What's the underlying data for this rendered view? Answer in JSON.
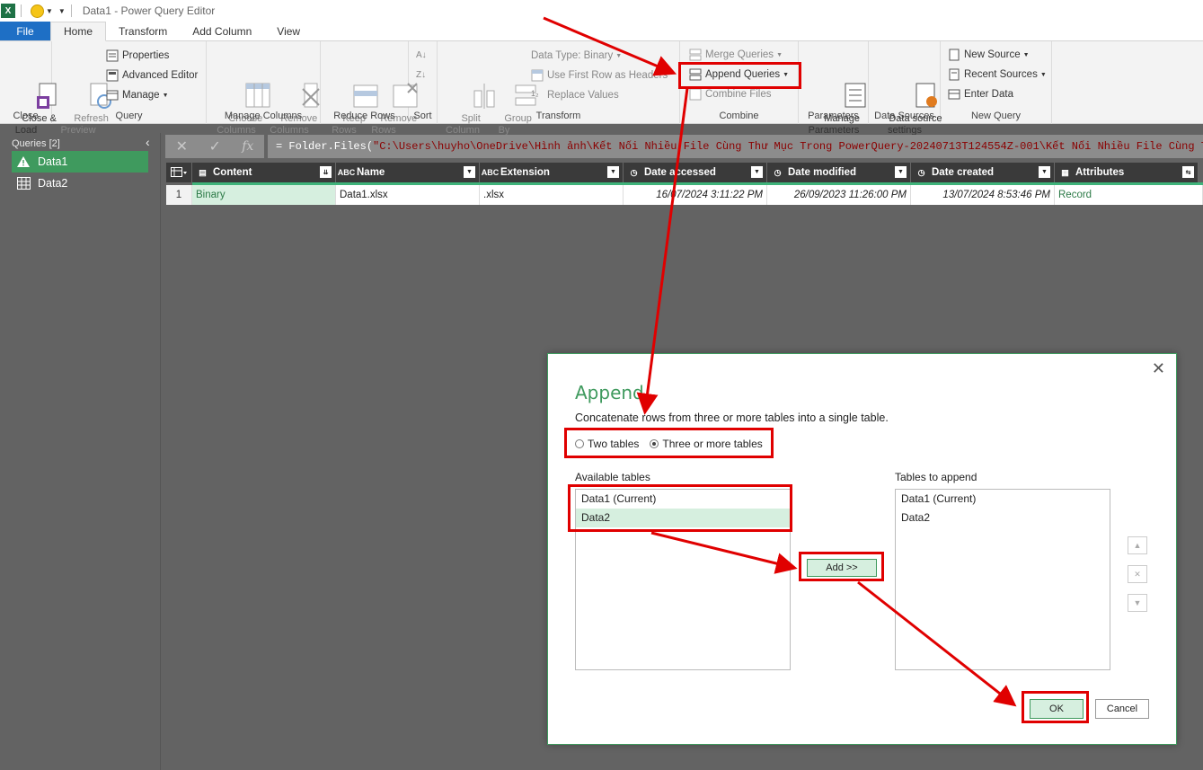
{
  "window": {
    "title": "Data1 - Power Query Editor",
    "app_logo": "X"
  },
  "tabs": [
    {
      "label": "File"
    },
    {
      "label": "Home"
    },
    {
      "label": "Transform"
    },
    {
      "label": "Add Column"
    },
    {
      "label": "View"
    }
  ],
  "ribbon": {
    "close": {
      "btn": "Close &\nLoad",
      "group": "Close"
    },
    "query": {
      "refresh": "Refresh\nPreview",
      "properties": "Properties",
      "advanced": "Advanced Editor",
      "manage": "Manage",
      "group": "Query"
    },
    "manage_columns": {
      "choose": "Choose\nColumns",
      "remove": "Remove\nColumns",
      "group": "Manage Columns"
    },
    "reduce_rows": {
      "keep": "Keep\nRows",
      "remove": "Remove\nRows",
      "group": "Reduce Rows"
    },
    "sort": {
      "group": "Sort"
    },
    "transform": {
      "split": "Split\nColumn",
      "group_by": "Group\nBy",
      "data_type": "Data Type: Binary",
      "first_row": "Use First Row as Headers",
      "replace": "Replace Values",
      "group": "Transform"
    },
    "combine": {
      "merge": "Merge Queries",
      "append": "Append Queries",
      "combine_files": "Combine Files",
      "group": "Combine"
    },
    "parameters": {
      "manage": "Manage\nParameters",
      "group": "Parameters"
    },
    "data_sources": {
      "settings": "Data source\nsettings",
      "group": "Data Sources"
    },
    "new_query": {
      "new_source": "New Source",
      "recent": "Recent Sources",
      "enter": "Enter Data",
      "group": "New Query"
    }
  },
  "formula": {
    "prefix": "= Folder.Files(",
    "string": "\"C:\\Users\\huyho\\OneDrive\\Hình ảnh\\Kết Nối Nhiều File Cùng Thư Mục Trong PowerQuery-20240713T124554Z-001\\Kết Nối Nhiều File Cùng Thư Mục Trong"
  },
  "queries": {
    "header": "Queries [2]",
    "items": [
      {
        "label": "Data1"
      },
      {
        "label": "Data2"
      }
    ]
  },
  "grid": {
    "columns": [
      "Content",
      "Name",
      "Extension",
      "Date accessed",
      "Date modified",
      "Date created",
      "Attributes"
    ],
    "row": {
      "index": "1",
      "content": "Binary",
      "name": "Data1.xlsx",
      "extension": ".xlsx",
      "accessed": "16/07/2024 3:11:22 PM",
      "modified": "26/09/2023 11:26:00 PM",
      "created": "13/07/2024 8:53:46 PM",
      "attributes": "Record"
    }
  },
  "dialog": {
    "title": "Append",
    "description": "Concatenate rows from three or more tables into a single table.",
    "radio_two": "Two tables",
    "radio_three": "Three or more tables",
    "available_label": "Available tables",
    "available": [
      "Data1 (Current)",
      "Data2"
    ],
    "append_label": "Tables to append",
    "to_append": [
      "Data1 (Current)",
      "Data2"
    ],
    "add_button": "Add >>",
    "ok": "OK",
    "cancel": "Cancel"
  },
  "colors": {
    "accent_green": "#3f9a5e",
    "file_blue": "#1e6fc5",
    "annotation_red": "#e00000"
  }
}
